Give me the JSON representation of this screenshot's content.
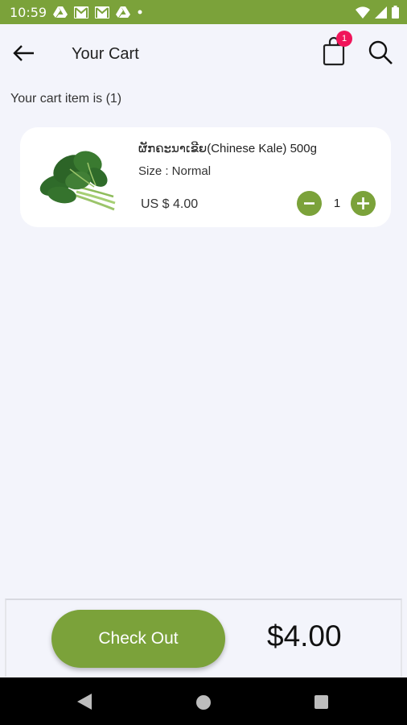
{
  "status_bar": {
    "time": "10:59",
    "left_icons": [
      "drive-icon",
      "gmail-icon",
      "gmail-icon",
      "drive-icon",
      "dot-icon"
    ],
    "right_icons": [
      "wifi-icon",
      "cell-signal-icon",
      "battery-icon"
    ]
  },
  "header": {
    "title": "Your Cart",
    "cart_badge_count": "1"
  },
  "cart": {
    "count_label": "Your cart item is (1)",
    "items": [
      {
        "name": "ຜັກຄະນາເຂີຍ(Chinese Kale) 500g",
        "size": "Size : Normal",
        "price": "US $ 4.00",
        "quantity": "1"
      }
    ]
  },
  "footer": {
    "checkout_label": "Check Out",
    "total": "$4.00"
  },
  "colors": {
    "accent": "#7ba23a",
    "badge": "#f0145a",
    "background": "#f3f4fb"
  }
}
